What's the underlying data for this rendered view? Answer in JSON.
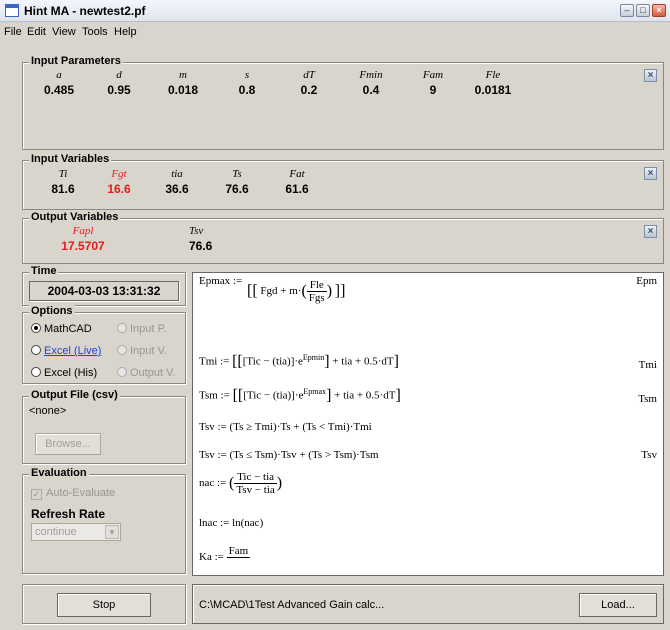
{
  "window": {
    "title": "Hint MA - newtest2.pf"
  },
  "menu": [
    "File",
    "Edit",
    "View",
    "Tools",
    "Help"
  ],
  "input_parameters": {
    "title": "Input Parameters",
    "items": [
      {
        "name": "a",
        "value": "0.485"
      },
      {
        "name": "d",
        "value": "0.95"
      },
      {
        "name": "m",
        "value": "0.018"
      },
      {
        "name": "s",
        "value": "0.8"
      },
      {
        "name": "dT",
        "value": "0.2"
      },
      {
        "name": "Fmin",
        "value": "0.4"
      },
      {
        "name": "Fam",
        "value": "9"
      },
      {
        "name": "Fle",
        "value": "0.0181"
      }
    ]
  },
  "input_variables": {
    "title": "Input Variables",
    "items": [
      {
        "name": "Ti",
        "value": "81.6"
      },
      {
        "name": "Fgt",
        "value": "16.6",
        "highlight": true
      },
      {
        "name": "tia",
        "value": "36.6"
      },
      {
        "name": "Ts",
        "value": "76.6"
      },
      {
        "name": "Fat",
        "value": "61.6"
      }
    ]
  },
  "output_variables": {
    "title": "Output Variables",
    "items": [
      {
        "name": "Fapl",
        "value": "17.5707",
        "highlight": true
      },
      {
        "name": "Tsv",
        "value": "76.6"
      }
    ]
  },
  "time": {
    "title": "Time",
    "value": "2004-03-03 13:31:32"
  },
  "options": {
    "title": "Options",
    "left": [
      {
        "label": "MathCAD",
        "checked": true
      },
      {
        "label": "Excel (Live)",
        "checked": false
      },
      {
        "label": "Excel (His)",
        "checked": false
      }
    ],
    "right": [
      "Input P.",
      "Input V.",
      "Output V."
    ]
  },
  "output_file": {
    "title": "Output File (csv)",
    "value": "<none>",
    "browse_label": "Browse..."
  },
  "evaluation": {
    "title": "Evaluation",
    "auto_evaluate_label": "Auto-Evaluate",
    "refresh_rate_label": "Refresh Rate",
    "refresh_rate_value": "continue"
  },
  "worksheet": {
    "top_label": "Epmax :=",
    "top_right": "Epm",
    "eq1_side": "Tmi",
    "eq2_side": "Tsm",
    "eq4_side": "Tsv",
    "lnac": "lnac := ln(nac)",
    "ka": "Ka :=",
    "ka_num": "Fam"
  },
  "stop_label": "Stop",
  "status_path": "C:\\MCAD\\1Test Advanced Gain calc...",
  "load_label": "Load..."
}
